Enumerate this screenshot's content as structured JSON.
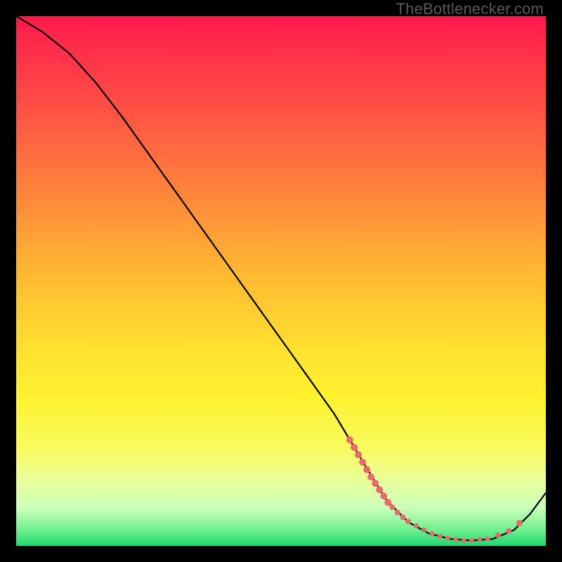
{
  "watermark": "TheBottlenecker.com",
  "chart_data": {
    "type": "line",
    "title": "",
    "xlabel": "",
    "ylabel": "",
    "xlim": [
      0,
      100
    ],
    "ylim": [
      0,
      100
    ],
    "series": [
      {
        "name": "bottleneck-curve",
        "x": [
          0,
          5,
          10,
          15,
          20,
          25,
          30,
          35,
          40,
          45,
          50,
          55,
          60,
          63,
          66,
          70,
          74,
          78,
          82,
          86,
          90,
          94,
          97,
          100
        ],
        "y": [
          100,
          97,
          93,
          87.5,
          81,
          74,
          67,
          60,
          53,
          46,
          39,
          32,
          25,
          20,
          15,
          8.5,
          4.5,
          2.3,
          1.3,
          1.0,
          1.3,
          3.0,
          6.0,
          10
        ]
      }
    ],
    "markers": {
      "name": "highlight-dots",
      "color": "#e76b6b",
      "points": [
        {
          "x": 63.0,
          "y": 20.0,
          "r": 5
        },
        {
          "x": 63.8,
          "y": 18.6,
          "r": 5
        },
        {
          "x": 64.6,
          "y": 17.2,
          "r": 5
        },
        {
          "x": 65.4,
          "y": 15.8,
          "r": 5
        },
        {
          "x": 66.2,
          "y": 14.4,
          "r": 5
        },
        {
          "x": 67.0,
          "y": 13.0,
          "r": 5
        },
        {
          "x": 67.8,
          "y": 11.8,
          "r": 5
        },
        {
          "x": 68.6,
          "y": 10.6,
          "r": 5
        },
        {
          "x": 69.4,
          "y": 9.4,
          "r": 5
        },
        {
          "x": 70.2,
          "y": 8.2,
          "r": 5
        },
        {
          "x": 71.0,
          "y": 7.3,
          "r": 4
        },
        {
          "x": 72.0,
          "y": 6.3,
          "r": 4
        },
        {
          "x": 73.0,
          "y": 5.4,
          "r": 4
        },
        {
          "x": 74.0,
          "y": 4.6,
          "r": 4
        },
        {
          "x": 75.5,
          "y": 3.8,
          "r": 3.5
        },
        {
          "x": 77.0,
          "y": 3.0,
          "r": 3.5
        },
        {
          "x": 78.5,
          "y": 2.3,
          "r": 3.5
        },
        {
          "x": 80.0,
          "y": 1.8,
          "r": 3.5
        },
        {
          "x": 81.5,
          "y": 1.5,
          "r": 3.5
        },
        {
          "x": 83.0,
          "y": 1.2,
          "r": 3.5
        },
        {
          "x": 84.5,
          "y": 1.0,
          "r": 3.5
        },
        {
          "x": 86.0,
          "y": 1.0,
          "r": 3.5
        },
        {
          "x": 87.5,
          "y": 1.2,
          "r": 3.5
        },
        {
          "x": 89.0,
          "y": 1.3,
          "r": 3.5
        },
        {
          "x": 91.0,
          "y": 2.0,
          "r": 4
        },
        {
          "x": 93.0,
          "y": 2.8,
          "r": 4
        },
        {
          "x": 95.0,
          "y": 4.3,
          "r": 4.5
        }
      ]
    }
  }
}
